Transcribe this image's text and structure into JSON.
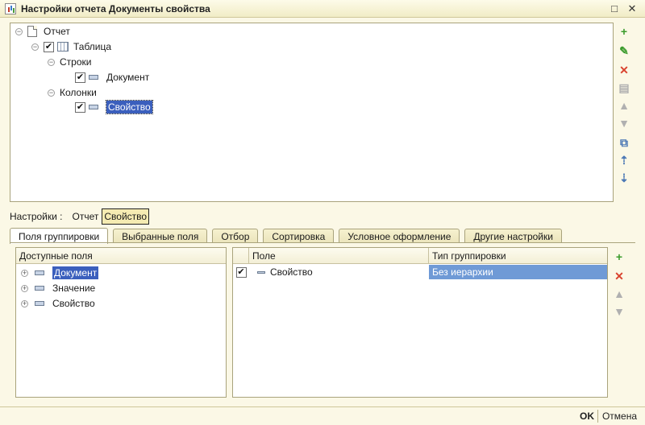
{
  "window": {
    "title": "Настройки отчета  Документы свойства",
    "minimize": "□",
    "close": "✕"
  },
  "tree": {
    "report": "Отчет",
    "table": "Таблица",
    "rows": "Строки",
    "document": "Документ",
    "columns": "Колонки",
    "property": "Свойство"
  },
  "settings": {
    "label": "Настройки :",
    "crumb_report": "Отчет",
    "crumb_active": "Свойство"
  },
  "tabs": [
    "Поля группировки",
    "Выбранные поля",
    "Отбор",
    "Сортировка",
    "Условное оформление",
    "Другие настройки"
  ],
  "available": {
    "header": "Доступные поля",
    "items": [
      "Документ",
      "Значение",
      "Свойство"
    ]
  },
  "grouping": {
    "col_field": "Поле",
    "col_type": "Тип группировки",
    "row_field": "Свойство",
    "row_type": "Без иерархии"
  },
  "footer": {
    "ok": "OK",
    "cancel": "Отмена"
  },
  "colors": {
    "selection": "#3b5fbd",
    "row_highlight": "#6f9ad6",
    "background": "#fbf8e6"
  }
}
